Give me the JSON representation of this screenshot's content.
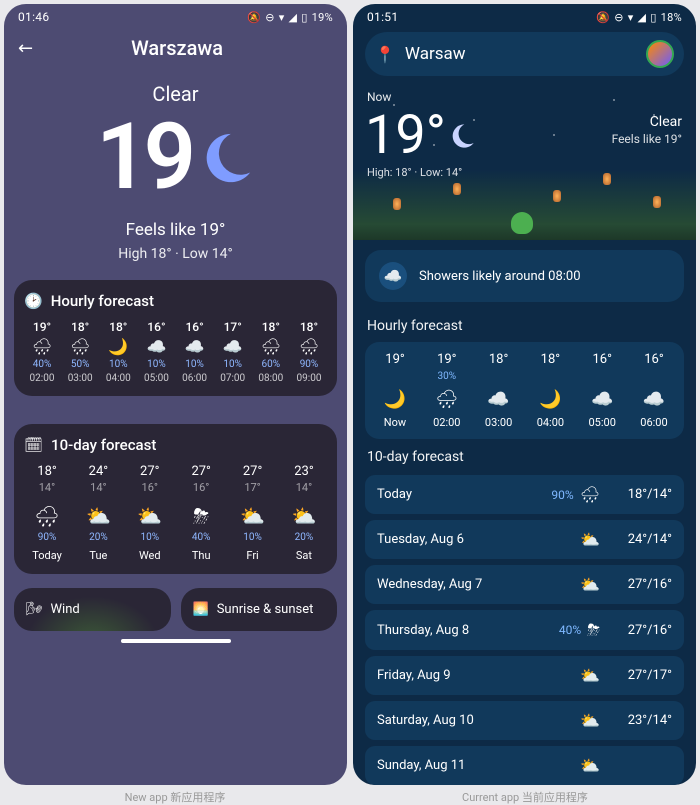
{
  "left": {
    "status": {
      "time": "01:46",
      "battery_pct": "19%"
    },
    "city": "Warszawa",
    "condition": "Clear",
    "temp": "19",
    "feels": "Feels like 19°",
    "hilo": "High 18° · Low 14°",
    "hourly_title": "Hourly forecast",
    "hourly": [
      {
        "temp": "19°",
        "percent": "40%",
        "time": "02:00"
      },
      {
        "temp": "18°",
        "percent": "50%",
        "time": "03:00"
      },
      {
        "temp": "18°",
        "percent": "10%",
        "time": "04:00"
      },
      {
        "temp": "16°",
        "percent": "10%",
        "time": "05:00"
      },
      {
        "temp": "16°",
        "percent": "10%",
        "time": "06:00"
      },
      {
        "temp": "17°",
        "percent": "10%",
        "time": "07:00"
      },
      {
        "temp": "18°",
        "percent": "60%",
        "time": "08:00"
      },
      {
        "temp": "18°",
        "percent": "90%",
        "time": "09:00"
      }
    ],
    "daily_title": "10-day forecast",
    "daily": [
      {
        "hi": "18°",
        "lo": "14°",
        "percent": "90%",
        "day": "Today"
      },
      {
        "hi": "24°",
        "lo": "14°",
        "percent": "20%",
        "day": "Tue"
      },
      {
        "hi": "27°",
        "lo": "16°",
        "percent": "10%",
        "day": "Wed"
      },
      {
        "hi": "27°",
        "lo": "16°",
        "percent": "40%",
        "day": "Thu"
      },
      {
        "hi": "27°",
        "lo": "17°",
        "percent": "10%",
        "day": "Fri"
      },
      {
        "hi": "23°",
        "lo": "14°",
        "percent": "20%",
        "day": "Sat"
      }
    ],
    "wind_label": "Wind",
    "sun_label": "Sunrise & sunset"
  },
  "right": {
    "status": {
      "time": "01:51",
      "battery_pct": "18%"
    },
    "city": "Warsaw",
    "now_label": "Now",
    "temp": "19°",
    "condition": "Clear",
    "feels": "Feels like 19°",
    "hilo": "High: 18° · Low: 14°",
    "alert": "Showers likely around 08:00",
    "hourly_title": "Hourly forecast",
    "hourly": [
      {
        "temp": "19°",
        "percent": "",
        "time": "Now"
      },
      {
        "temp": "19°",
        "percent": "30%",
        "time": "02:00"
      },
      {
        "temp": "18°",
        "percent": "",
        "time": "03:00"
      },
      {
        "temp": "18°",
        "percent": "",
        "time": "04:00"
      },
      {
        "temp": "16°",
        "percent": "",
        "time": "05:00"
      },
      {
        "temp": "16°",
        "percent": "",
        "time": "06:00"
      }
    ],
    "daily_title": "10-day forecast",
    "daily": [
      {
        "day": "Today",
        "percent": "90%",
        "range": "18°/14°"
      },
      {
        "day": "Tuesday, Aug 6",
        "percent": "",
        "range": "24°/14°"
      },
      {
        "day": "Wednesday, Aug 7",
        "percent": "",
        "range": "27°/16°"
      },
      {
        "day": "Thursday, Aug 8",
        "percent": "40%",
        "range": "27°/16°"
      },
      {
        "day": "Friday, Aug 9",
        "percent": "",
        "range": "27°/17°"
      },
      {
        "day": "Saturday, Aug 10",
        "percent": "",
        "range": "23°/14°"
      },
      {
        "day": "Sunday, Aug 11",
        "percent": "",
        "range": ""
      }
    ]
  },
  "captions": {
    "left": "New app 新应用程序",
    "right": "Current app 当前应用程序"
  }
}
